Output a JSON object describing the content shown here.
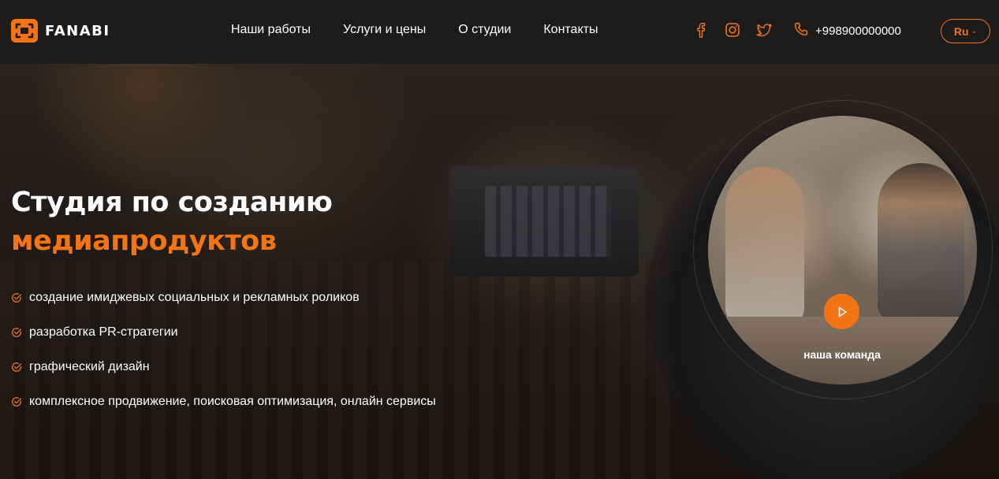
{
  "brand": {
    "name": "FANABI",
    "accent": "#f47414"
  },
  "nav": {
    "items": [
      "Наши работы",
      "Услуги и цены",
      "О студии",
      "Контакты"
    ]
  },
  "social": [
    "facebook-icon",
    "instagram-icon",
    "twitter-icon"
  ],
  "contact": {
    "phone": "+998900000000"
  },
  "language": {
    "selected": "Ru"
  },
  "hero": {
    "title_line1": "Студия по созданию",
    "title_line2": "медиапродуктов",
    "features": [
      "создание имиджевых социальных и рекламных роликов",
      "разработка PR-стратегии",
      "графический дизайн",
      "комплексное продвижение, поисковая оптимизация, онлайн сервисы"
    ],
    "video_label": "наша команда"
  }
}
